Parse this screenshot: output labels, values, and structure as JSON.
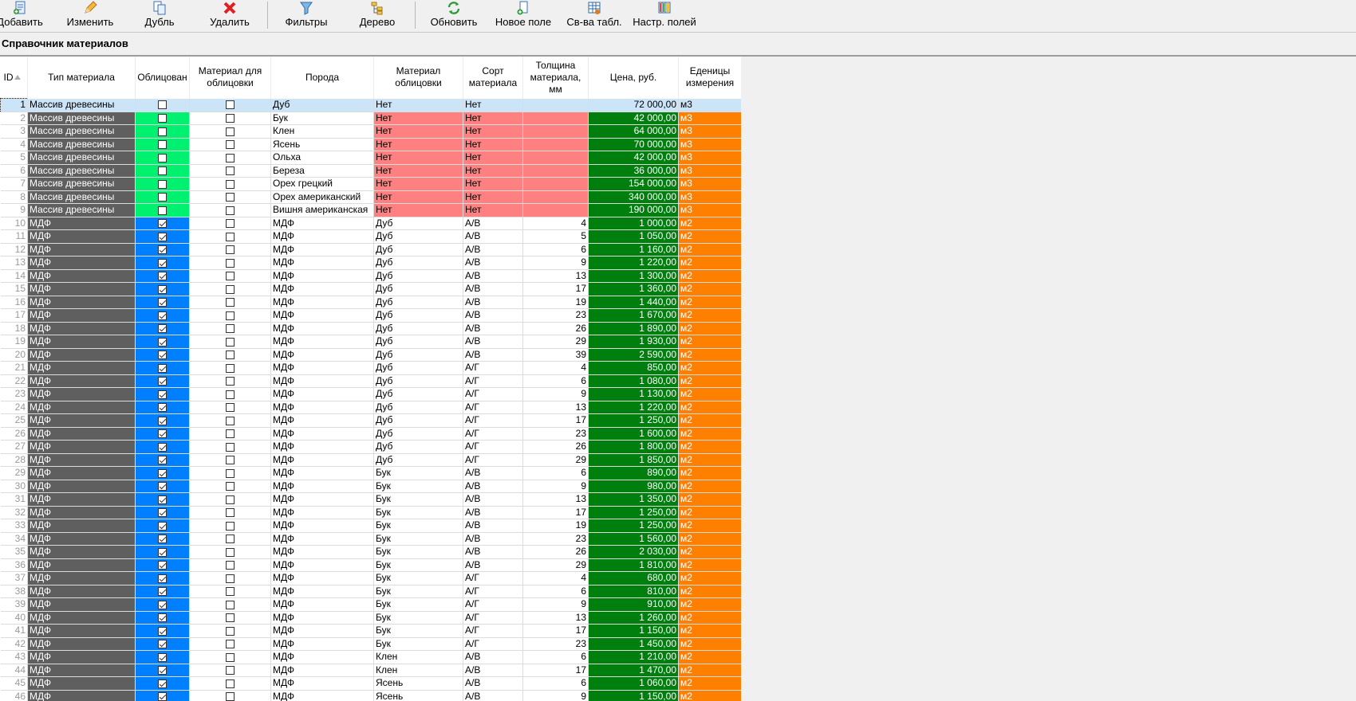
{
  "toolbar": {
    "buttons": [
      {
        "label": "Добавить",
        "icon": "add-doc-icon"
      },
      {
        "label": "Изменить",
        "icon": "pencil-icon"
      },
      {
        "label": "Дубль",
        "icon": "duplicate-icon"
      },
      {
        "label": "Удалить",
        "icon": "red-x-icon"
      },
      {
        "label": "Фильтры",
        "icon": "filter-funnel-icon"
      },
      {
        "label": "Дерево",
        "icon": "tree-icon"
      },
      {
        "label": "Обновить",
        "icon": "refresh-icon"
      },
      {
        "label": "Новое поле",
        "icon": "new-field-icon"
      },
      {
        "label": "Св-ва табл.",
        "icon": "table-props-icon"
      },
      {
        "label": "Настр. полей",
        "icon": "field-settings-icon"
      }
    ]
  },
  "page": {
    "title": "Справочник материалов"
  },
  "grid": {
    "columns": [
      "ID",
      "Тип материала",
      "Облицован",
      "Материал для облицовки",
      "Порода",
      "Материал облицовки",
      "Сорт материала",
      "Толщина материала, мм",
      "Цена, руб.",
      "Еденицы измерения"
    ],
    "colors": {
      "type": "#5f5f5f",
      "clad_no": "#00f070",
      "clad_yes": "#0080ff",
      "cladmat_no": "#ff8080",
      "price": "#007f0e",
      "unit": "#ff8000",
      "selected": "#cce4f7"
    },
    "rows": [
      {
        "id": "1",
        "type": "Массив древесины",
        "clad": false,
        "cm": false,
        "breed": "Дуб",
        "mat": "Нет",
        "grade": "Нет",
        "thick": "",
        "price": "72 000,00",
        "unit": "м3"
      },
      {
        "id": "2",
        "type": "Массив древесины",
        "clad": false,
        "cm": false,
        "breed": "Бук",
        "mat": "Нет",
        "grade": "Нет",
        "thick": "",
        "price": "42 000,00",
        "unit": "м3"
      },
      {
        "id": "3",
        "type": "Массив древесины",
        "clad": false,
        "cm": false,
        "breed": "Клен",
        "mat": "Нет",
        "grade": "Нет",
        "thick": "",
        "price": "64 000,00",
        "unit": "м3"
      },
      {
        "id": "4",
        "type": "Массив древесины",
        "clad": false,
        "cm": false,
        "breed": "Ясень",
        "mat": "Нет",
        "grade": "Нет",
        "thick": "",
        "price": "70 000,00",
        "unit": "м3"
      },
      {
        "id": "5",
        "type": "Массив древесины",
        "clad": false,
        "cm": false,
        "breed": "Ольха",
        "mat": "Нет",
        "grade": "Нет",
        "thick": "",
        "price": "42 000,00",
        "unit": "м3"
      },
      {
        "id": "6",
        "type": "Массив древесины",
        "clad": false,
        "cm": false,
        "breed": "Береза",
        "mat": "Нет",
        "grade": "Нет",
        "thick": "",
        "price": "36 000,00",
        "unit": "м3"
      },
      {
        "id": "7",
        "type": "Массив древесины",
        "clad": false,
        "cm": false,
        "breed": "Орех грецкий",
        "mat": "Нет",
        "grade": "Нет",
        "thick": "",
        "price": "154 000,00",
        "unit": "м3"
      },
      {
        "id": "8",
        "type": "Массив древесины",
        "clad": false,
        "cm": false,
        "breed": "Орех американский",
        "mat": "Нет",
        "grade": "Нет",
        "thick": "",
        "price": "340 000,00",
        "unit": "м3"
      },
      {
        "id": "9",
        "type": "Массив древесины",
        "clad": false,
        "cm": false,
        "breed": "Вишня американская",
        "mat": "Нет",
        "grade": "Нет",
        "thick": "",
        "price": "190 000,00",
        "unit": "м3"
      },
      {
        "id": "10",
        "type": "МДФ",
        "clad": true,
        "cm": false,
        "breed": "МДФ",
        "mat": "Дуб",
        "grade": "А/В",
        "thick": "4",
        "price": "1 000,00",
        "unit": "м2"
      },
      {
        "id": "11",
        "type": "МДФ",
        "clad": true,
        "cm": false,
        "breed": "МДФ",
        "mat": "Дуб",
        "grade": "А/В",
        "thick": "5",
        "price": "1 050,00",
        "unit": "м2"
      },
      {
        "id": "12",
        "type": "МДФ",
        "clad": true,
        "cm": false,
        "breed": "МДФ",
        "mat": "Дуб",
        "grade": "А/В",
        "thick": "6",
        "price": "1 160,00",
        "unit": "м2"
      },
      {
        "id": "13",
        "type": "МДФ",
        "clad": true,
        "cm": false,
        "breed": "МДФ",
        "mat": "Дуб",
        "grade": "А/В",
        "thick": "9",
        "price": "1 220,00",
        "unit": "м2"
      },
      {
        "id": "14",
        "type": "МДФ",
        "clad": true,
        "cm": false,
        "breed": "МДФ",
        "mat": "Дуб",
        "grade": "А/В",
        "thick": "13",
        "price": "1 300,00",
        "unit": "м2"
      },
      {
        "id": "15",
        "type": "МДФ",
        "clad": true,
        "cm": false,
        "breed": "МДФ",
        "mat": "Дуб",
        "grade": "А/В",
        "thick": "17",
        "price": "1 360,00",
        "unit": "м2"
      },
      {
        "id": "16",
        "type": "МДФ",
        "clad": true,
        "cm": false,
        "breed": "МДФ",
        "mat": "Дуб",
        "grade": "А/В",
        "thick": "19",
        "price": "1 440,00",
        "unit": "м2"
      },
      {
        "id": "17",
        "type": "МДФ",
        "clad": true,
        "cm": false,
        "breed": "МДФ",
        "mat": "Дуб",
        "grade": "А/В",
        "thick": "23",
        "price": "1 670,00",
        "unit": "м2"
      },
      {
        "id": "18",
        "type": "МДФ",
        "clad": true,
        "cm": false,
        "breed": "МДФ",
        "mat": "Дуб",
        "grade": "А/В",
        "thick": "26",
        "price": "1 890,00",
        "unit": "м2"
      },
      {
        "id": "19",
        "type": "МДФ",
        "clad": true,
        "cm": false,
        "breed": "МДФ",
        "mat": "Дуб",
        "grade": "А/В",
        "thick": "29",
        "price": "1 930,00",
        "unit": "м2"
      },
      {
        "id": "20",
        "type": "МДФ",
        "clad": true,
        "cm": false,
        "breed": "МДФ",
        "mat": "Дуб",
        "grade": "А/В",
        "thick": "39",
        "price": "2 590,00",
        "unit": "м2"
      },
      {
        "id": "21",
        "type": "МДФ",
        "clad": true,
        "cm": false,
        "breed": "МДФ",
        "mat": "Дуб",
        "grade": "А/Г",
        "thick": "4",
        "price": "850,00",
        "unit": "м2"
      },
      {
        "id": "22",
        "type": "МДФ",
        "clad": true,
        "cm": false,
        "breed": "МДФ",
        "mat": "Дуб",
        "grade": "А/Г",
        "thick": "6",
        "price": "1 080,00",
        "unit": "м2"
      },
      {
        "id": "23",
        "type": "МДФ",
        "clad": true,
        "cm": false,
        "breed": "МДФ",
        "mat": "Дуб",
        "grade": "А/Г",
        "thick": "9",
        "price": "1 130,00",
        "unit": "м2"
      },
      {
        "id": "24",
        "type": "МДФ",
        "clad": true,
        "cm": false,
        "breed": "МДФ",
        "mat": "Дуб",
        "grade": "А/Г",
        "thick": "13",
        "price": "1 220,00",
        "unit": "м2"
      },
      {
        "id": "25",
        "type": "МДФ",
        "clad": true,
        "cm": false,
        "breed": "МДФ",
        "mat": "Дуб",
        "grade": "А/Г",
        "thick": "17",
        "price": "1 250,00",
        "unit": "м2"
      },
      {
        "id": "26",
        "type": "МДФ",
        "clad": true,
        "cm": false,
        "breed": "МДФ",
        "mat": "Дуб",
        "grade": "А/Г",
        "thick": "23",
        "price": "1 600,00",
        "unit": "м2"
      },
      {
        "id": "27",
        "type": "МДФ",
        "clad": true,
        "cm": false,
        "breed": "МДФ",
        "mat": "Дуб",
        "grade": "А/Г",
        "thick": "26",
        "price": "1 800,00",
        "unit": "м2"
      },
      {
        "id": "28",
        "type": "МДФ",
        "clad": true,
        "cm": false,
        "breed": "МДФ",
        "mat": "Дуб",
        "grade": "А/Г",
        "thick": "29",
        "price": "1 850,00",
        "unit": "м2"
      },
      {
        "id": "29",
        "type": "МДФ",
        "clad": true,
        "cm": false,
        "breed": "МДФ",
        "mat": "Бук",
        "grade": "А/В",
        "thick": "6",
        "price": "890,00",
        "unit": "м2"
      },
      {
        "id": "30",
        "type": "МДФ",
        "clad": true,
        "cm": false,
        "breed": "МДФ",
        "mat": "Бук",
        "grade": "А/В",
        "thick": "9",
        "price": "980,00",
        "unit": "м2"
      },
      {
        "id": "31",
        "type": "МДФ",
        "clad": true,
        "cm": false,
        "breed": "МДФ",
        "mat": "Бук",
        "grade": "А/В",
        "thick": "13",
        "price": "1 350,00",
        "unit": "м2"
      },
      {
        "id": "32",
        "type": "МДФ",
        "clad": true,
        "cm": false,
        "breed": "МДФ",
        "mat": "Бук",
        "grade": "А/В",
        "thick": "17",
        "price": "1 250,00",
        "unit": "м2"
      },
      {
        "id": "33",
        "type": "МДФ",
        "clad": true,
        "cm": false,
        "breed": "МДФ",
        "mat": "Бук",
        "grade": "А/В",
        "thick": "19",
        "price": "1 250,00",
        "unit": "м2"
      },
      {
        "id": "34",
        "type": "МДФ",
        "clad": true,
        "cm": false,
        "breed": "МДФ",
        "mat": "Бук",
        "grade": "А/В",
        "thick": "23",
        "price": "1 560,00",
        "unit": "м2"
      },
      {
        "id": "35",
        "type": "МДФ",
        "clad": true,
        "cm": false,
        "breed": "МДФ",
        "mat": "Бук",
        "grade": "А/В",
        "thick": "26",
        "price": "2 030,00",
        "unit": "м2"
      },
      {
        "id": "36",
        "type": "МДФ",
        "clad": true,
        "cm": false,
        "breed": "МДФ",
        "mat": "Бук",
        "grade": "А/В",
        "thick": "29",
        "price": "1 810,00",
        "unit": "м2"
      },
      {
        "id": "37",
        "type": "МДФ",
        "clad": true,
        "cm": false,
        "breed": "МДФ",
        "mat": "Бук",
        "grade": "А/Г",
        "thick": "4",
        "price": "680,00",
        "unit": "м2"
      },
      {
        "id": "38",
        "type": "МДФ",
        "clad": true,
        "cm": false,
        "breed": "МДФ",
        "mat": "Бук",
        "grade": "А/Г",
        "thick": "6",
        "price": "810,00",
        "unit": "м2"
      },
      {
        "id": "39",
        "type": "МДФ",
        "clad": true,
        "cm": false,
        "breed": "МДФ",
        "mat": "Бук",
        "grade": "А/Г",
        "thick": "9",
        "price": "910,00",
        "unit": "м2"
      },
      {
        "id": "40",
        "type": "МДФ",
        "clad": true,
        "cm": false,
        "breed": "МДФ",
        "mat": "Бук",
        "grade": "А/Г",
        "thick": "13",
        "price": "1 260,00",
        "unit": "м2"
      },
      {
        "id": "41",
        "type": "МДФ",
        "clad": true,
        "cm": false,
        "breed": "МДФ",
        "mat": "Бук",
        "grade": "А/Г",
        "thick": "17",
        "price": "1 150,00",
        "unit": "м2"
      },
      {
        "id": "42",
        "type": "МДФ",
        "clad": true,
        "cm": false,
        "breed": "МДФ",
        "mat": "Бук",
        "grade": "А/Г",
        "thick": "23",
        "price": "1 450,00",
        "unit": "м2"
      },
      {
        "id": "43",
        "type": "МДФ",
        "clad": true,
        "cm": false,
        "breed": "МДФ",
        "mat": "Клен",
        "grade": "А/В",
        "thick": "6",
        "price": "1 210,00",
        "unit": "м2"
      },
      {
        "id": "44",
        "type": "МДФ",
        "clad": true,
        "cm": false,
        "breed": "МДФ",
        "mat": "Клен",
        "grade": "А/В",
        "thick": "17",
        "price": "1 470,00",
        "unit": "м2"
      },
      {
        "id": "45",
        "type": "МДФ",
        "clad": true,
        "cm": false,
        "breed": "МДФ",
        "mat": "Ясень",
        "grade": "А/В",
        "thick": "6",
        "price": "1 060,00",
        "unit": "м2"
      },
      {
        "id": "46",
        "type": "МДФ",
        "clad": true,
        "cm": false,
        "breed": "МДФ",
        "mat": "Ясень",
        "grade": "А/В",
        "thick": "9",
        "price": "1 150,00",
        "unit": "м2"
      }
    ]
  }
}
